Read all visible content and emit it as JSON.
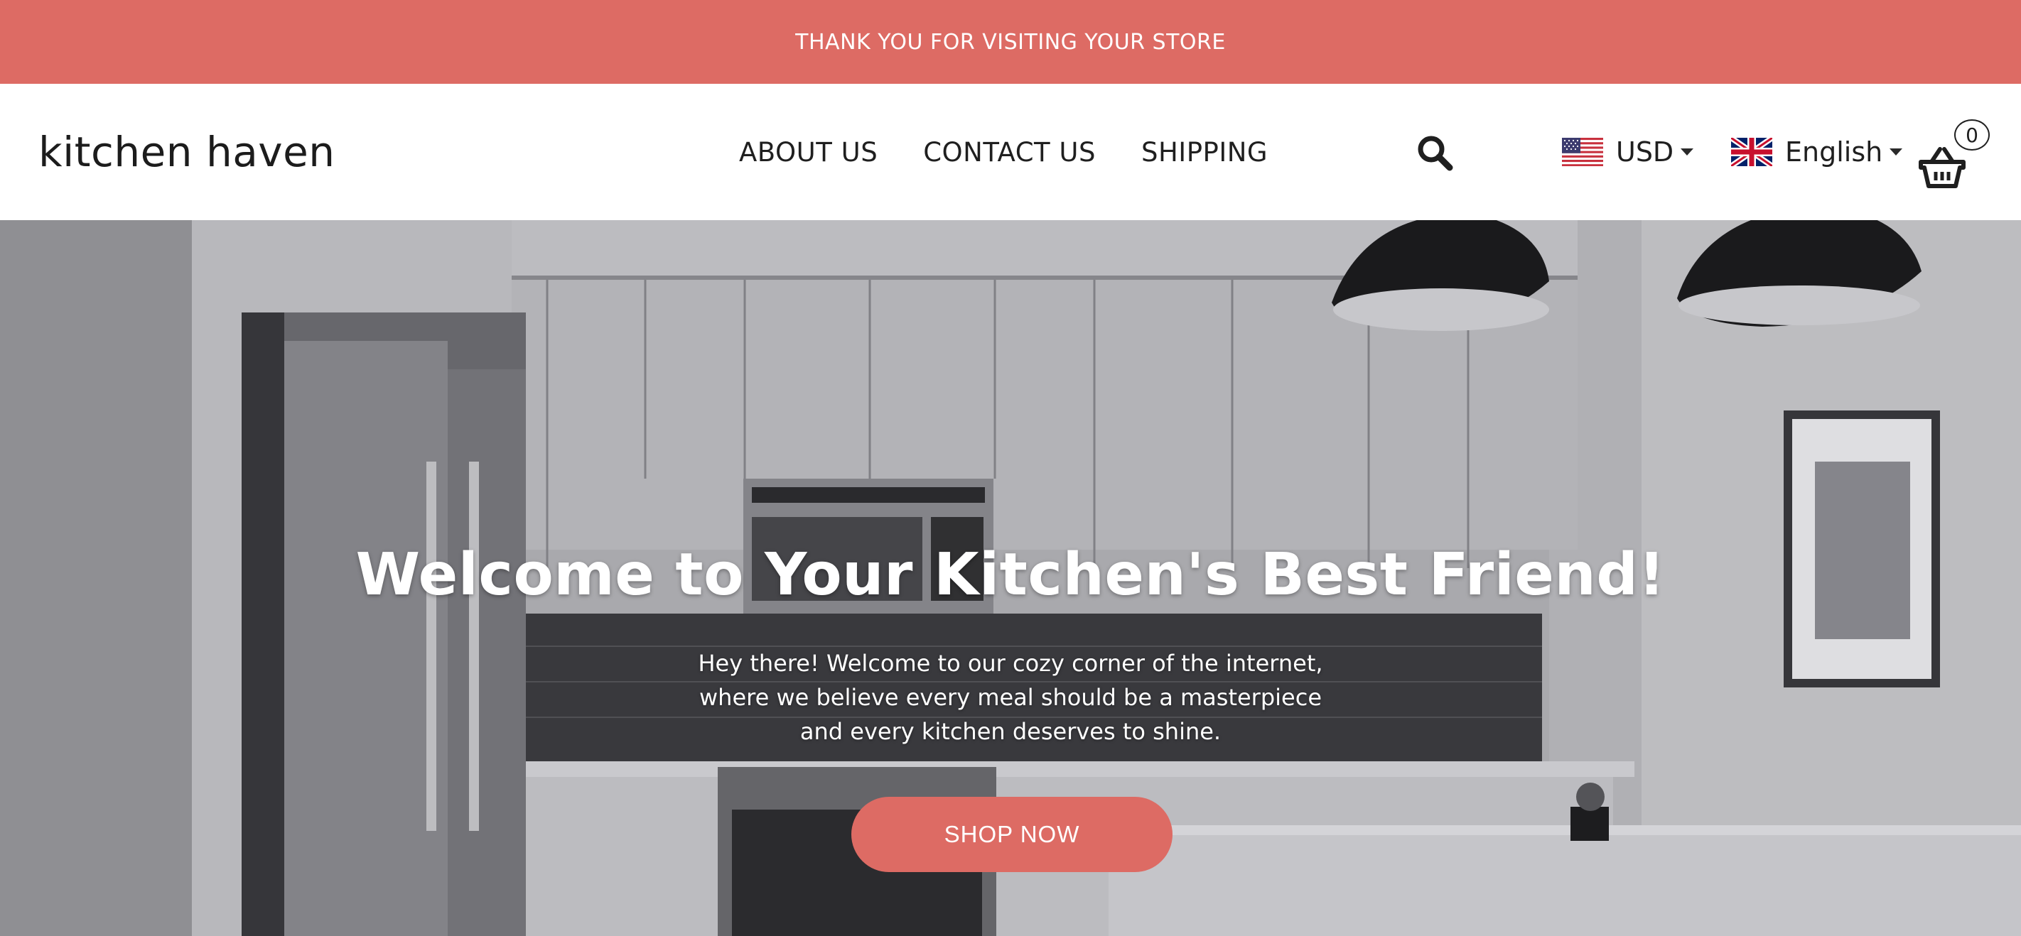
{
  "announcement": {
    "text": "THANK YOU FOR VISITING YOUR STORE"
  },
  "header": {
    "logo": "kitchen haven",
    "nav": [
      {
        "label": "ABOUT US"
      },
      {
        "label": "CONTACT US"
      },
      {
        "label": "SHIPPING"
      }
    ],
    "search_icon": "search-icon",
    "currency": {
      "flag": "us-flag-icon",
      "label": "USD"
    },
    "language": {
      "flag": "uk-flag-icon",
      "label": "English"
    },
    "cart": {
      "icon": "basket-icon",
      "count": "0"
    }
  },
  "hero": {
    "title": "Welcome to Your Kitchen's Best Friend!",
    "text_lines": [
      "Hey there! Welcome to our cozy corner of the internet,",
      "where we believe every meal should be a masterpiece",
      "and every kitchen deserves to shine."
    ],
    "button": "SHOP NOW"
  },
  "colors": {
    "accent": "#dd6b64",
    "text": "#1f1f1f",
    "hero_text": "#ffffff"
  }
}
